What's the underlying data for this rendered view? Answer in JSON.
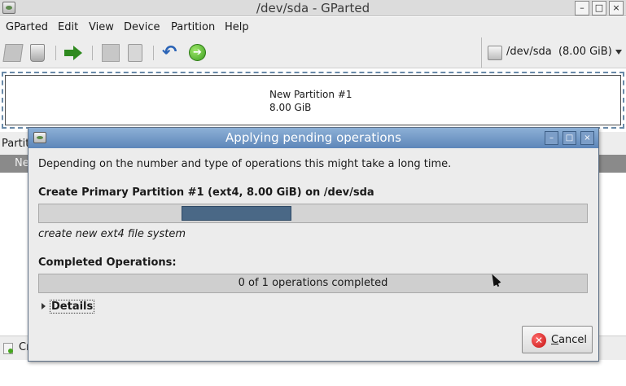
{
  "window": {
    "title": "/dev/sda - GParted",
    "min_glyph": "–",
    "max_glyph": "□",
    "close_glyph": "×"
  },
  "menubar": {
    "items": [
      "GParted",
      "Edit",
      "View",
      "Device",
      "Partition",
      "Help"
    ]
  },
  "toolbar": {
    "undo_glyph": "↶",
    "apply_glyph": "➔",
    "device_selector": {
      "label": "/dev/sda  (8.00 GiB)"
    }
  },
  "partition_graph": {
    "name": "New Partition #1",
    "size": "8.00 GiB"
  },
  "background": {
    "tab_label": "Partit",
    "column_header": "Ne",
    "pending_status": "Cr"
  },
  "dialog": {
    "title": "Applying pending operations",
    "description": "Depending on the number and type of operations this might take a long time.",
    "operation_title": "Create Primary Partition #1 (ext4, 8.00 GiB) on /dev/sda",
    "operation_progress": {
      "start_fraction": 0.26,
      "end_fraction": 0.46
    },
    "operation_status": "create new ext4 file system",
    "completed_label": "Completed Operations:",
    "completed_text": "0 of 1 operations completed",
    "details_label": "Details",
    "cancel_label": "Cancel",
    "cancel_glyph": "✕"
  },
  "colors": {
    "dialog_titlebar": "#6f95c4",
    "progress_fill": "#4a6886",
    "apply_green": "#3c9d1f",
    "cancel_red": "#c41010"
  }
}
